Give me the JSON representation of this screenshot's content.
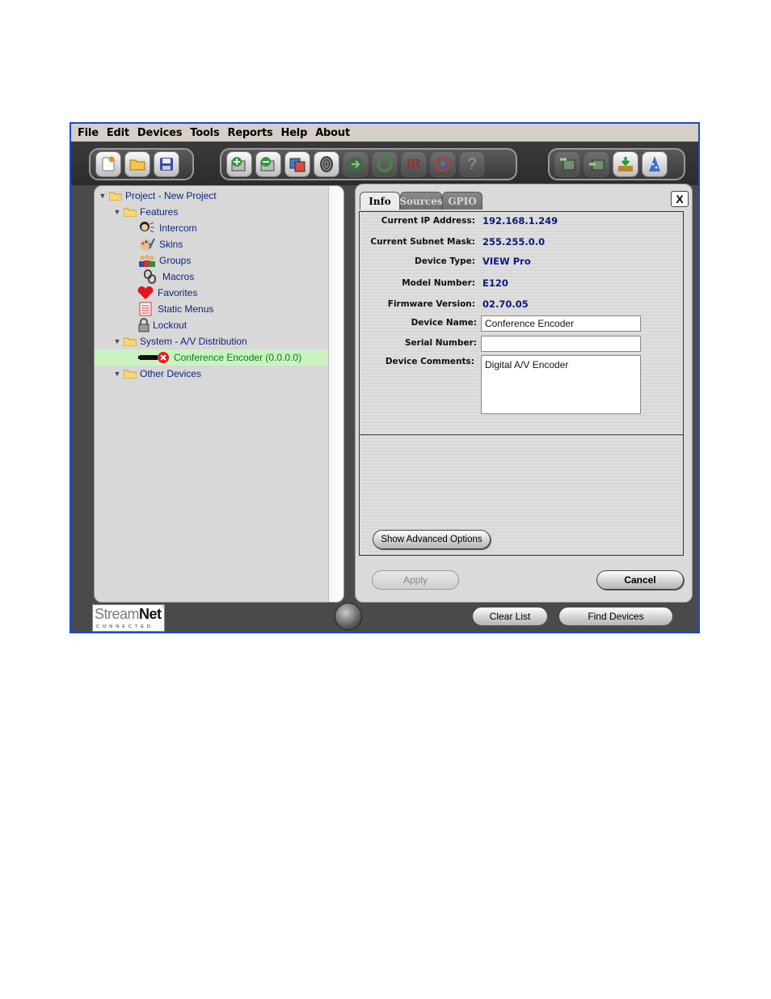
{
  "menu": [
    "File",
    "Edit",
    "Devices",
    "Tools",
    "Reports",
    "Help",
    "About"
  ],
  "toolbar": {
    "group1": [
      "new-project-icon",
      "open-folder-icon",
      "save-icon"
    ],
    "group2": [
      "add-device-icon",
      "remove-device-icon",
      "copy-device-icon",
      "fingerprint-icon",
      "forward-arrow-icon",
      "refresh-icon",
      "ir-icon",
      "target-icon",
      "help-icon"
    ],
    "group2_ir_label": "IR",
    "group2_help_label": "?",
    "group3": [
      "import-icon",
      "export-icon",
      "download-icon",
      "wizard-icon"
    ]
  },
  "tree": {
    "project": "Project - New Project",
    "features": "Features",
    "feature_items": [
      "Intercom",
      "Skins",
      "Groups",
      "Macros",
      "Favorites",
      "Static Menus",
      "Lockout"
    ],
    "system": "System - A/V Distribution",
    "selected_device": "Conference Encoder (0.0.0.0)",
    "other": "Other Devices"
  },
  "detail": {
    "tabs": [
      "Info",
      "Sources",
      "GPIO"
    ],
    "close_label": "X",
    "fields": {
      "ip_label": "Current IP Address:",
      "ip_value": "192.168.1.249",
      "subnet_label": "Current Subnet Mask:",
      "subnet_value": "255.255.0.0",
      "type_label": "Device Type:",
      "type_value": "VIEW Pro",
      "model_label": "Model Number:",
      "model_value": "E120",
      "firmware_label": "Firmware Version:",
      "firmware_value": "02.70.05",
      "name_label": "Device Name:",
      "name_value": "Conference Encoder",
      "serial_label": "Serial Number:",
      "serial_value": "",
      "comments_label": "Device Comments:",
      "comments_value": "Digital A/V Encoder"
    },
    "advanced_button": "Show Advanced Options",
    "apply_button": "Apply",
    "cancel_button": "Cancel"
  },
  "footer": {
    "logo_main_a": "Stream",
    "logo_main_b": "Net",
    "logo_tm": "™",
    "logo_sub": "CONNECTED",
    "clear_button": "Clear List",
    "find_button": "Find Devices"
  }
}
